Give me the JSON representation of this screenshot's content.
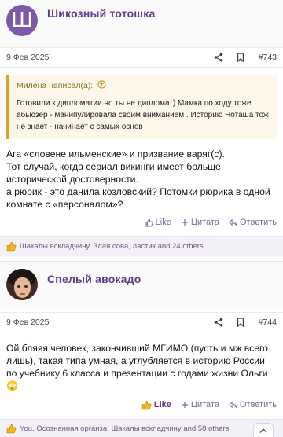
{
  "posts": [
    {
      "author": "Шикозный тотошка",
      "avatar_letter": "Ш",
      "date": "9 Фев 2025",
      "number": "#743",
      "quote": {
        "author_line": "Милена написал(а):",
        "text": "Готовили к дипломатии но ты не дипломат) Мамка по ходу тоже абьюзер - манипулировала своим вниманием . Историю Ноташа тож не знает - начинает с самых основ"
      },
      "message": [
        "Ага «словене ильменские» и призвание варяг(с).",
        "Тот случай, когда сериал викинги имеет больше исторической достоверности.",
        "а рюрик - это данила козловский? Потомки рюрика в одной комнате с «персоналом»?"
      ],
      "actions": {
        "like": "Like",
        "quote": "Цитата",
        "reply": "Ответить"
      },
      "reactions": "Шакалы вскладчину, Злая сова, ластик and 24 others"
    },
    {
      "author": "Спелый авокадо",
      "date": "9 Фев 2025",
      "number": "#744",
      "message": [
        "Ой бляяя человек, закончивший МГИМО (пусть и мж всего лишь), такая типа умная, а углубляется в историю России по учебнику 6 класса и презентации с годами жизни Ольги 🙄"
      ],
      "actions": {
        "like": "Like",
        "quote": "Цитата",
        "reply": "Ответить"
      },
      "reactions": "You, Осознанная органза, Шакалы вскладчину and 58 others"
    }
  ],
  "colors": {
    "accent": "#5d3d8a",
    "avatar_bg": "#7d5aa8",
    "quote_border": "#e0a020"
  },
  "icons": [
    "share-icon",
    "bookmark-icon",
    "arrow-up-circle-icon",
    "thumbs-up-icon",
    "quote-icon",
    "reply-icon",
    "scroll-up-icon"
  ]
}
